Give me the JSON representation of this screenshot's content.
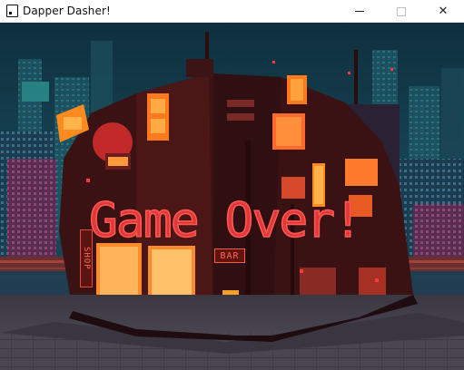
{
  "window": {
    "title": "Dapper Dasher!",
    "app_icon": "app-window-icon",
    "controls": {
      "minimize": "minimize-icon",
      "maximize": "maximize-icon",
      "close": "close-icon",
      "close_glyph": "✕"
    }
  },
  "game": {
    "overlay_text": "Game Over!",
    "signs": {
      "bar": "BAR",
      "shop": "SHOP"
    },
    "colors": {
      "sky": "#12384a",
      "building": "#3a1214",
      "neon_red": "#e0383a",
      "neon_orange": "#ff8a2a",
      "street": "#4b4651"
    }
  }
}
